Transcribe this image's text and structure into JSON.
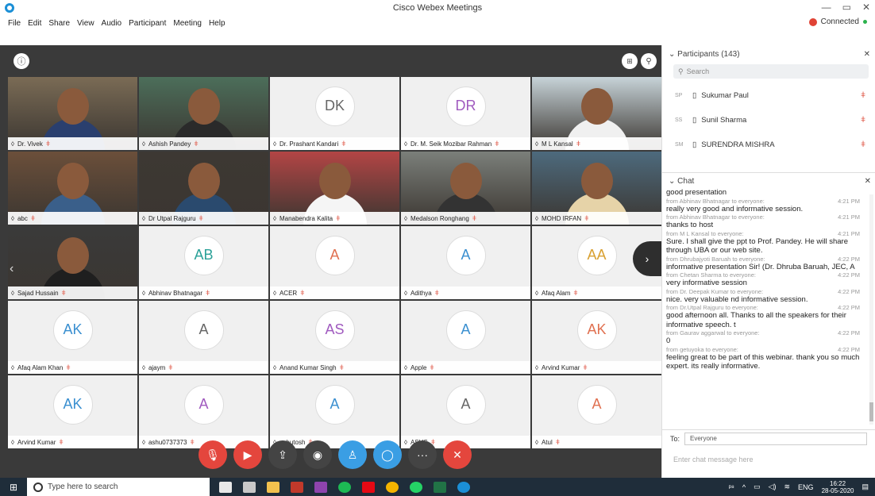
{
  "window": {
    "title": "Cisco Webex Meetings",
    "controls": [
      "—",
      "▭",
      "✕"
    ]
  },
  "menu": [
    "File",
    "Edit",
    "Share",
    "View",
    "Audio",
    "Participant",
    "Meeting",
    "Help"
  ],
  "connection": {
    "status": "Connected"
  },
  "tiles": [
    {
      "name": "Dr. Vivek",
      "type": "video",
      "bg": "#7a6b55",
      "shirt": "#2a3f6e",
      "selected": true
    },
    {
      "name": "Ashish Pandey",
      "type": "video",
      "bg": "#4c6e5a",
      "shirt": "#2a2a2a"
    },
    {
      "name": "Dr. Prashant Kandari",
      "type": "initials",
      "initials": "DK",
      "color": "#666666"
    },
    {
      "name": "Dr. M. Seik Mozibar Rahman",
      "type": "initials",
      "initials": "DR",
      "color": "#a05abf"
    },
    {
      "name": "M L Kansal",
      "type": "video",
      "bg": "#c7d3d8",
      "shirt": "#f0f0f0"
    },
    {
      "name": "abc",
      "type": "video",
      "bg": "#6b4f3a",
      "shirt": "#3a5f8a"
    },
    {
      "name": "Dr Utpal Rajguru",
      "type": "video",
      "bg": "#3d3833",
      "shirt": "#2a4a6e"
    },
    {
      "name": "Manabendra Kalita",
      "type": "video",
      "bg": "#b34545",
      "shirt": "#f5f5f5"
    },
    {
      "name": "Medalson Ronghang",
      "type": "video",
      "bg": "#7b7f7a",
      "shirt": "#333333"
    },
    {
      "name": "MOHD IRFAN",
      "type": "video",
      "bg": "#4d6a7d",
      "shirt": "#e6d3a8"
    },
    {
      "name": "Sajad Hussain",
      "type": "video",
      "bg": "#3a3a3a",
      "shirt": "#1f1f1f"
    },
    {
      "name": "Abhinav Bhatnagar",
      "type": "initials",
      "initials": "AB",
      "color": "#2aa198"
    },
    {
      "name": "ACER",
      "type": "initials",
      "initials": "A",
      "color": "#e07050"
    },
    {
      "name": "Adithya",
      "type": "initials",
      "initials": "A",
      "color": "#3a8fd0"
    },
    {
      "name": "Afaq Alam",
      "type": "initials",
      "initials": "AA",
      "color": "#d9a030"
    },
    {
      "name": "Afaq Alam Khan",
      "type": "initials",
      "initials": "AK",
      "color": "#3a8fd0"
    },
    {
      "name": "ajaym",
      "type": "initials",
      "initials": "A",
      "color": "#666666"
    },
    {
      "name": "Anand Kumar Singh",
      "type": "initials",
      "initials": "AS",
      "color": "#a05abf"
    },
    {
      "name": "Apple",
      "type": "initials",
      "initials": "A",
      "color": "#3a8fd0"
    },
    {
      "name": "Arvind Kumar",
      "type": "initials",
      "initials": "AK",
      "color": "#e07050"
    },
    {
      "name": "Arvind Kumar",
      "type": "initials",
      "initials": "AK",
      "color": "#3a8fd0"
    },
    {
      "name": "ashu0737373",
      "type": "initials",
      "initials": "A",
      "color": "#a05abf"
    },
    {
      "name": "ashutosh",
      "type": "initials",
      "initials": "A",
      "color": "#3a8fd0"
    },
    {
      "name": "ASUS",
      "type": "initials",
      "initials": "A",
      "color": "#666666"
    },
    {
      "name": "Atul",
      "type": "initials",
      "initials": "A",
      "color": "#e07050"
    }
  ],
  "controls": [
    {
      "name": "mute",
      "icon": "mic-muted-icon",
      "glyph": "🎙",
      "color": "#e4463d"
    },
    {
      "name": "video",
      "icon": "video-off-icon",
      "glyph": "▶",
      "color": "#e4463d"
    },
    {
      "name": "share",
      "icon": "share-icon",
      "glyph": "⇪",
      "color": "#444444"
    },
    {
      "name": "record",
      "icon": "record-icon",
      "glyph": "◉",
      "color": "#444444"
    },
    {
      "name": "participants",
      "icon": "participants-icon",
      "glyph": "♙",
      "color": "#3a9ee4"
    },
    {
      "name": "chat",
      "icon": "chat-icon",
      "glyph": "◯",
      "color": "#3a9ee4"
    },
    {
      "name": "more",
      "icon": "more-icon",
      "glyph": "···",
      "color": "#444444"
    },
    {
      "name": "leave",
      "icon": "leave-icon",
      "glyph": "✕",
      "color": "#e4463d"
    }
  ],
  "participants": {
    "title": "Participants (143)",
    "search_placeholder": "Search",
    "items": [
      {
        "initials": "SP",
        "name": "Sukumar Paul"
      },
      {
        "initials": "SS",
        "name": "Sunil Sharma"
      },
      {
        "initials": "SM",
        "name": "SURENDRA MISHRA"
      }
    ]
  },
  "chat": {
    "title": "Chat",
    "messages": [
      {
        "from": "",
        "time": "",
        "text": "good presentation"
      },
      {
        "from": "from Abhinav Bhatnagar to everyone:",
        "time": "4:21 PM",
        "text": "really  very good and informative session."
      },
      {
        "from": "from Abhinav Bhatnagar to everyone:",
        "time": "4:21 PM",
        "text": "thanks to host"
      },
      {
        "from": "from M L Kansal to everyone:",
        "time": "4:21 PM",
        "text": "Sure. I shall give the ppt to Prof. Pandey.  He will share through UBA or our web site."
      },
      {
        "from": "from Dhrubajyoti Baruah to everyone:",
        "time": "4:22 PM",
        "text": "informative presentation Sir! (Dr. Dhruba Baruah, JEC, A"
      },
      {
        "from": "from Chetan Sharma to everyone:",
        "time": "4:22 PM",
        "text": "very informative session"
      },
      {
        "from": "from Dr. Deepak Kumar to everyone:",
        "time": "4:22 PM",
        "text": "nice. very valuable nd informative session."
      },
      {
        "from": "from Dr.Utpal Rajguru to everyone:",
        "time": "4:22 PM",
        "text": "good afternoon all. Thanks to all the speakers for their informative speech. t"
      },
      {
        "from": "from Gaurav aggarwal to everyone:",
        "time": "4:22 PM",
        "text": "0"
      },
      {
        "from": "from getuyoka to everyone:",
        "time": "4:22 PM",
        "text": "feeling great to be part of this webinar. thank you so much expert. its really informative."
      }
    ],
    "to_label": "To:",
    "to_value": "Everyone",
    "input_placeholder": "Enter chat message here"
  },
  "taskbar": {
    "search_placeholder": "Type here to search",
    "lang": "ENG",
    "time": "16:22",
    "date": "28-05-2020"
  }
}
